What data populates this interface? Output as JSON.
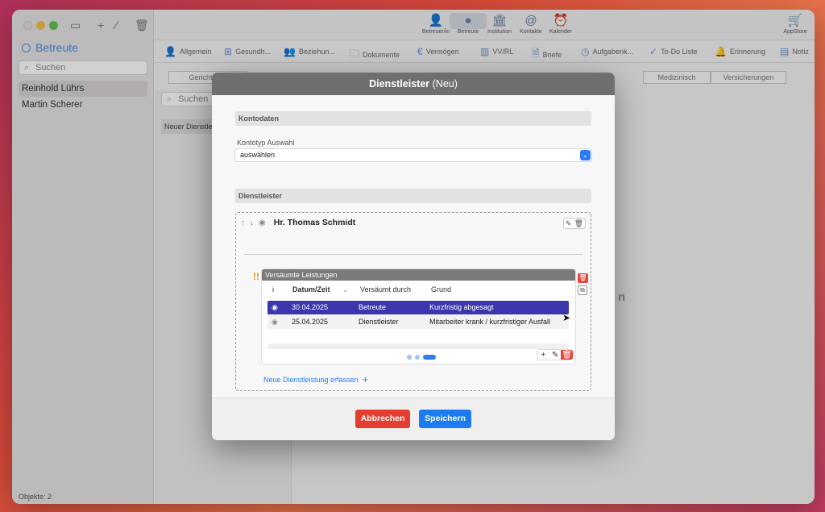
{
  "sidebar": {
    "title": "Betreute",
    "search_placeholder": "Suchen",
    "items": [
      {
        "label": "Reinhold Lührs",
        "selected": true
      },
      {
        "label": "Martin Scherer",
        "selected": false
      }
    ],
    "footer": "Objekte: 2"
  },
  "midcol": {
    "search_placeholder": "Suchen",
    "item": "Neuer Dienstlei"
  },
  "toolbar": {
    "buttons": [
      {
        "label": "Betreuer/in",
        "icon": "person-icon"
      },
      {
        "label": "Betreute",
        "icon": "person-filled-icon",
        "selected": true
      },
      {
        "label": "Institution",
        "icon": "building-icon"
      },
      {
        "label": "Kontakte",
        "icon": "at-icon"
      },
      {
        "label": "Kalender",
        "icon": "alarm-icon"
      }
    ],
    "appstore": "AppStore"
  },
  "tabs": [
    {
      "label": "Allgemein",
      "icon": "person-icon"
    },
    {
      "label": "Gesundh...",
      "icon": "health-icon"
    },
    {
      "label": "Beziehun...",
      "icon": "people-icon"
    },
    {
      "label": "Dokumente",
      "icon": "folder-icon"
    },
    {
      "label": "Vermögen",
      "icon": "euro-icon"
    },
    {
      "label": "VV/RL",
      "icon": "chart-icon"
    },
    {
      "label": "Briefe",
      "icon": "doc-icon"
    },
    {
      "label": "Aufgabenk...",
      "icon": "clock-icon"
    },
    {
      "label": "To-Do Liste",
      "icon": "check-icon"
    },
    {
      "label": "Erinnerung",
      "icon": "bell-icon"
    },
    {
      "label": "Notiz",
      "icon": "note-icon"
    }
  ],
  "subtabs": {
    "first": "Gerichtl. Be",
    "medical": "Medizinisch",
    "insurance": "Versicherungen"
  },
  "background_letter": "n",
  "modal": {
    "title": "Dienstleister",
    "title_suffix": "(Neu)",
    "section_account": "Kontodaten",
    "account_type_label": "Kontotyp Auswahl",
    "account_type_value": "auswählen",
    "section_provider": "Dienstleister",
    "provider_name": "Hr. Thomas Schmidt",
    "warning_mark": "!!",
    "missed": {
      "title": "Versäumte Leistungen",
      "columns": {
        "i": "i",
        "date": "Datum/Zeit",
        "by": "Versäumt durch",
        "reason": "Grund"
      },
      "rows": [
        {
          "date": "30.04.2025",
          "by": "Betreute",
          "reason": "Kurzfristig abgesagt",
          "selected": true
        },
        {
          "date": "25.04.2025",
          "by": "Dienstleister",
          "reason": "Mitarbeiter krank / kurzfristiger Ausfall",
          "selected": false
        }
      ]
    },
    "new_service_link": "Neue Dienstleistung erfassen",
    "cancel_label": "Abbrechen",
    "save_label": "Speichern"
  },
  "colors": {
    "accent": "#2d7cf6",
    "selected_row": "#3a37ad",
    "danger": "#e53d2f",
    "warning": "#f08c1a"
  }
}
